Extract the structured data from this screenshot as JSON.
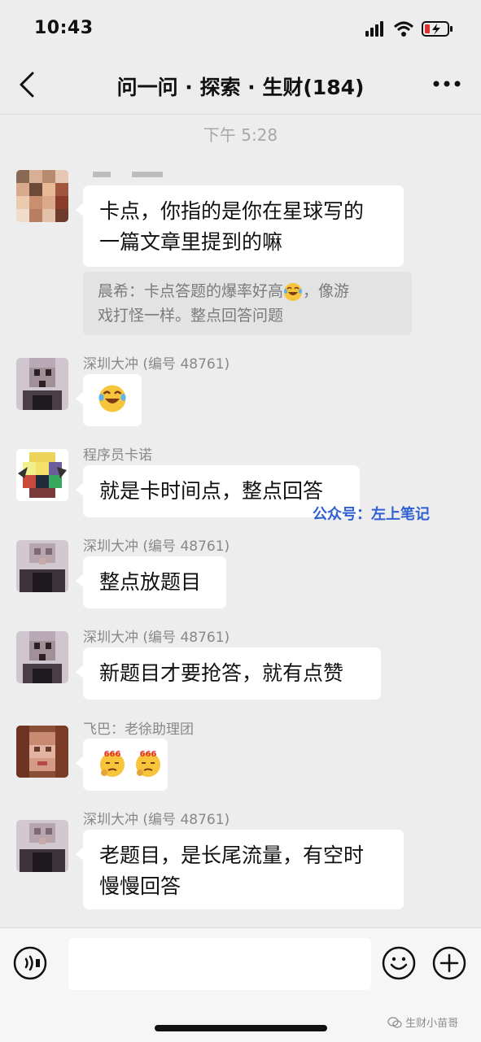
{
  "status": {
    "time": "10:43"
  },
  "nav": {
    "title": "问一问 · 探索 · 生财(184)"
  },
  "timestamp": "下午 5:28",
  "messages": [
    {
      "sender": "",
      "text_lines": [
        "卡点，你指的是你在星球写的",
        "一篇文章里提到的嘛"
      ]
    },
    {
      "sender": "深圳大冲 (编号 48761)",
      "emoji": "laughing-tears"
    },
    {
      "sender": "程序员卡诺",
      "text": "就是卡时间点，整点回答"
    },
    {
      "sender": "深圳大冲 (编号 48761)",
      "text": "整点放题目"
    },
    {
      "sender": "深圳大冲 (编号 48761)",
      "text": "新题目才要抢答，就有点赞"
    },
    {
      "sender": "飞巴：老徐助理团",
      "emoji": "666-thinking"
    },
    {
      "sender": "深圳大冲 (编号 48761)",
      "text_lines": [
        "老题目，是长尾流量，有空时",
        "慢慢回答"
      ]
    }
  ],
  "quote": {
    "line1": "晨希：卡点答题的爆率好高",
    "line1_suffix": "，像游",
    "line2": "戏打怪一样。整点回答问题"
  },
  "watermark": "公众号：左上笔记",
  "footer": {
    "mark": "生财小苗哥"
  },
  "emoji_badge": "666",
  "colors": {
    "background": "#ededed",
    "bubble": "#ffffff",
    "watermark": "#2f5fd1"
  }
}
